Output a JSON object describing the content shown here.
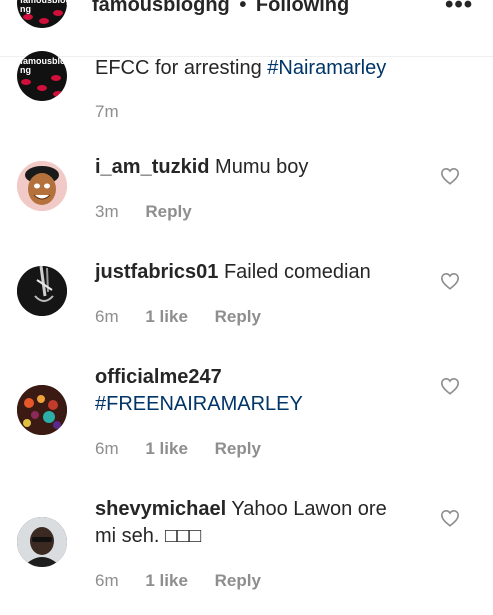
{
  "header": {
    "username": "famousblogng",
    "separator": "•",
    "follow_status": "Following",
    "more": "•••",
    "avatar_text": "famousblog ng"
  },
  "caption": {
    "text": "EFCC for arresting",
    "hashtag": "#Nairamarley",
    "time": "7m"
  },
  "comments": [
    {
      "user": "i_am_tuzkid",
      "text": "Mumu boy",
      "time": "3m",
      "likes": "",
      "reply": "Reply"
    },
    {
      "user": "justfabrics01",
      "text": "Failed comedian",
      "time": "6m",
      "likes": "1 like",
      "reply": "Reply"
    },
    {
      "user": "officialme247",
      "hashtag": "#FREENAIRAMARLEY",
      "time": "6m",
      "likes": "1 like",
      "reply": "Reply"
    },
    {
      "user": "shevymichael",
      "text": "Yahoo Lawon ore",
      "text2": "mi seh. □□□",
      "time": "6m",
      "likes": "1 like",
      "reply": "Reply"
    }
  ],
  "colors": {
    "hashtag": "#003569",
    "meta": "#8e8e8e",
    "text": "#262626",
    "heart": "#8e8e8e"
  },
  "icons": [
    "heart-outline-icon",
    "more-options-icon"
  ]
}
